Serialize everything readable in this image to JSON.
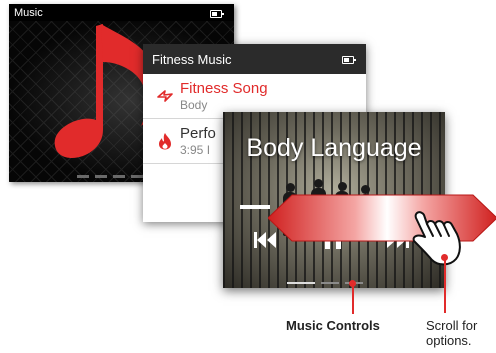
{
  "music_screen": {
    "title": "Music"
  },
  "fitness_screen": {
    "title": "Fitness Music",
    "items": [
      {
        "title": "Fitness Song",
        "subtitle": "Body",
        "icon": "lightning-icon",
        "title_color": "#e12b2b"
      },
      {
        "title": "Perfo",
        "subtitle": "3:95 I",
        "icon": "flame-icon",
        "title_color": "#333333"
      }
    ]
  },
  "player_screen": {
    "song_title": "Body Language",
    "controls": [
      "previous-icon",
      "pause-icon",
      "next-icon"
    ]
  },
  "callouts": {
    "music_controls": "Music Controls",
    "scroll_line1": "Scroll for",
    "scroll_line2": "options."
  },
  "colors": {
    "accent_red": "#e12b2b",
    "dark_bar": "#2b2b2b"
  }
}
